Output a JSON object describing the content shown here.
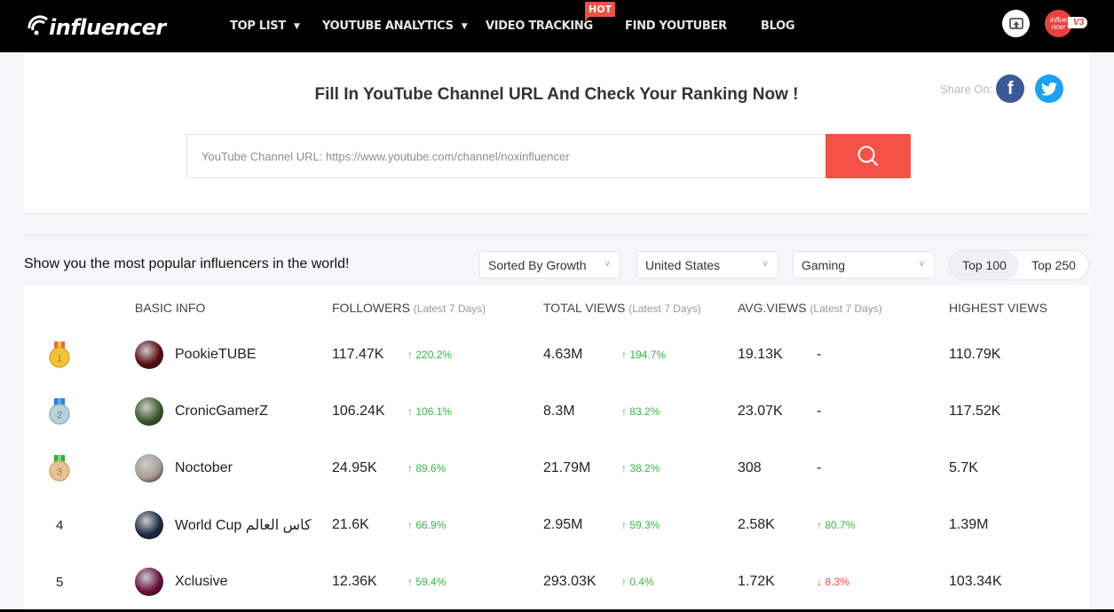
{
  "header": {
    "logo_text": "influencer",
    "nav": [
      {
        "label": "TOP LIST",
        "dropdown": true
      },
      {
        "label": "YOUTUBE ANALYTICS",
        "dropdown": true
      },
      {
        "label": "VIDEO TRACKING",
        "dropdown": false,
        "badge": "HOT"
      },
      {
        "label": "FIND YOUTUBER",
        "dropdown": false
      },
      {
        "label": "BLOG",
        "dropdown": false
      }
    ],
    "avatar_text": "influe ncer",
    "version_badge": "V3"
  },
  "search": {
    "title": "Fill In YouTube Channel URL And Check Your Ranking Now !",
    "placeholder": "YouTube Channel URL: https://www.youtube.com/channel/noxinfluencer",
    "share_label": "Share On:",
    "facebook_glyph": "f"
  },
  "filters": {
    "tagline": "Show you the most popular influencers in the world!",
    "sort": "Sorted By Growth",
    "country": "United States",
    "category": "Gaming",
    "toggle": [
      {
        "label": "Top 100",
        "active": true
      },
      {
        "label": "Top 250",
        "active": false
      }
    ]
  },
  "table": {
    "headers": {
      "basic_info": "BASIC INFO",
      "followers": "FOLLOWERS",
      "total_views": "TOTAL VIEWS",
      "avg_views": "AVG.VIEWS",
      "highest_views": "HIGHEST VIEWS",
      "period_note": "(Latest 7 Days)"
    },
    "rows": [
      {
        "rank": "1",
        "medal": "gold",
        "name": "PookieTUBE",
        "followers": "117.47K",
        "followers_change": "220.2%",
        "followers_dir": "up",
        "views": "4.63M",
        "views_change": "194.7%",
        "views_dir": "up",
        "avg": "19.13K",
        "avg_change": "-",
        "avg_dir": "none",
        "highest": "110.79K",
        "avatar_color": "#5a0c10"
      },
      {
        "rank": "2",
        "medal": "silver",
        "name": "CronicGamerZ",
        "followers": "106.24K",
        "followers_change": "106.1%",
        "followers_dir": "up",
        "views": "8.3M",
        "views_change": "83.2%",
        "views_dir": "up",
        "avg": "23.07K",
        "avg_change": "-",
        "avg_dir": "none",
        "highest": "117.52K",
        "avatar_color": "#3e5a2a"
      },
      {
        "rank": "3",
        "medal": "bronze",
        "name": "Noctober",
        "followers": "24.95K",
        "followers_change": "89.6%",
        "followers_dir": "up",
        "views": "21.79M",
        "views_change": "38.2%",
        "views_dir": "up",
        "avg": "308",
        "avg_change": "-",
        "avg_dir": "none",
        "highest": "5.7K",
        "avatar_color": "#a89c92"
      },
      {
        "rank": "4",
        "medal": "",
        "name": "World Cup كاس العالم",
        "followers": "21.6K",
        "followers_change": "66.9%",
        "followers_dir": "up",
        "views": "2.95M",
        "views_change": "59.3%",
        "views_dir": "up",
        "avg": "2.58K",
        "avg_change": "80.7%",
        "avg_dir": "up",
        "highest": "1.39M",
        "avatar_color": "#1f2a44"
      },
      {
        "rank": "5",
        "medal": "",
        "name": "Xclusive",
        "followers": "12.36K",
        "followers_change": "59.4%",
        "followers_dir": "up",
        "views": "293.03K",
        "views_change": "0.4%",
        "views_dir": "up",
        "avg": "1.72K",
        "avg_change": "8.3%",
        "avg_dir": "down",
        "highest": "103.34K",
        "avatar_color": "#6a1240"
      }
    ]
  },
  "colors": {
    "accent": "#f45246",
    "up": "#3ab44a",
    "down": "#ee4a4a",
    "facebook": "#3b5998",
    "twitter": "#1da1f2"
  }
}
